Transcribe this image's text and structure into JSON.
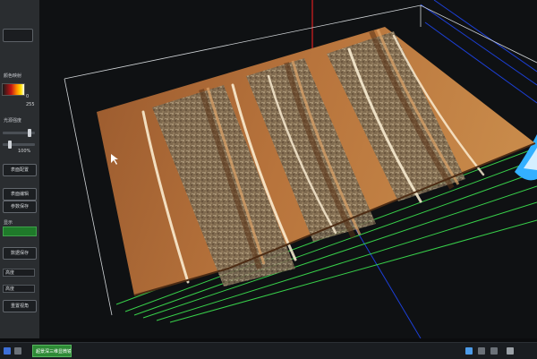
{
  "panel": {
    "colorbar_label": "颜色映射",
    "colorbar_max": "0",
    "colorbar_min": "255",
    "section_label": "光源强度",
    "slider_value": "100%",
    "buttons": [
      "表面配置",
      "表面编辑",
      "参数保存",
      "数据保存"
    ],
    "field_label": "显示",
    "dropdown_value": "高度",
    "dropdown_value_2": "高度",
    "bottom_button": "重置视角"
  },
  "taskbar": {
    "task_label": "超景深三维显微镜..."
  },
  "colors": {
    "background": "#15181b",
    "panel": "#2a2d30",
    "accent_green": "#2e8a36",
    "grid_green": "#38d04a",
    "axis_blue": "#1c3fd6",
    "axis_red": "#d81f1f",
    "sample_orange": "#b56a33"
  }
}
